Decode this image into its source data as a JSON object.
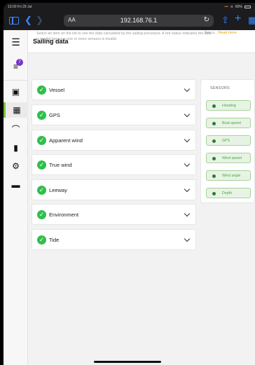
{
  "status_bar": {
    "time": "13:00",
    "date": "Fri 29 Jul",
    "battery": "80%"
  },
  "browser": {
    "text_size_label": "AA",
    "url": "192.168.76.1"
  },
  "rail": {
    "alerts_badge": "7"
  },
  "header": {
    "title": "Sailing data"
  },
  "intro": {
    "text": "Select an item on the list to see the data calculated by the sailing processor. A red status indicates the data is invalid because one or more sensors is invalid.",
    "see_prefix": "See a...",
    "read_more": "Read more"
  },
  "items": [
    {
      "label": "Vessel",
      "status": "valid"
    },
    {
      "label": "GPS",
      "status": "valid"
    },
    {
      "label": "Apparent wind",
      "status": "valid"
    },
    {
      "label": "True wind",
      "status": "valid"
    },
    {
      "label": "Leeway",
      "status": "valid"
    },
    {
      "label": "Environment",
      "status": "valid"
    },
    {
      "label": "Tide",
      "status": "valid"
    }
  ],
  "sensors": {
    "title": "SENSORS",
    "items": [
      {
        "label": "Heading"
      },
      {
        "label": "Boat speed"
      },
      {
        "label": "GPS"
      },
      {
        "label": "Wind speed"
      },
      {
        "label": "Wind angle"
      },
      {
        "label": "Depth"
      }
    ]
  },
  "colors": {
    "accent": "#7ac142",
    "valid": "#2fbf4a",
    "badge": "#7b2fd0",
    "link": "#e0a400",
    "browser_blue": "#3a86ff"
  }
}
